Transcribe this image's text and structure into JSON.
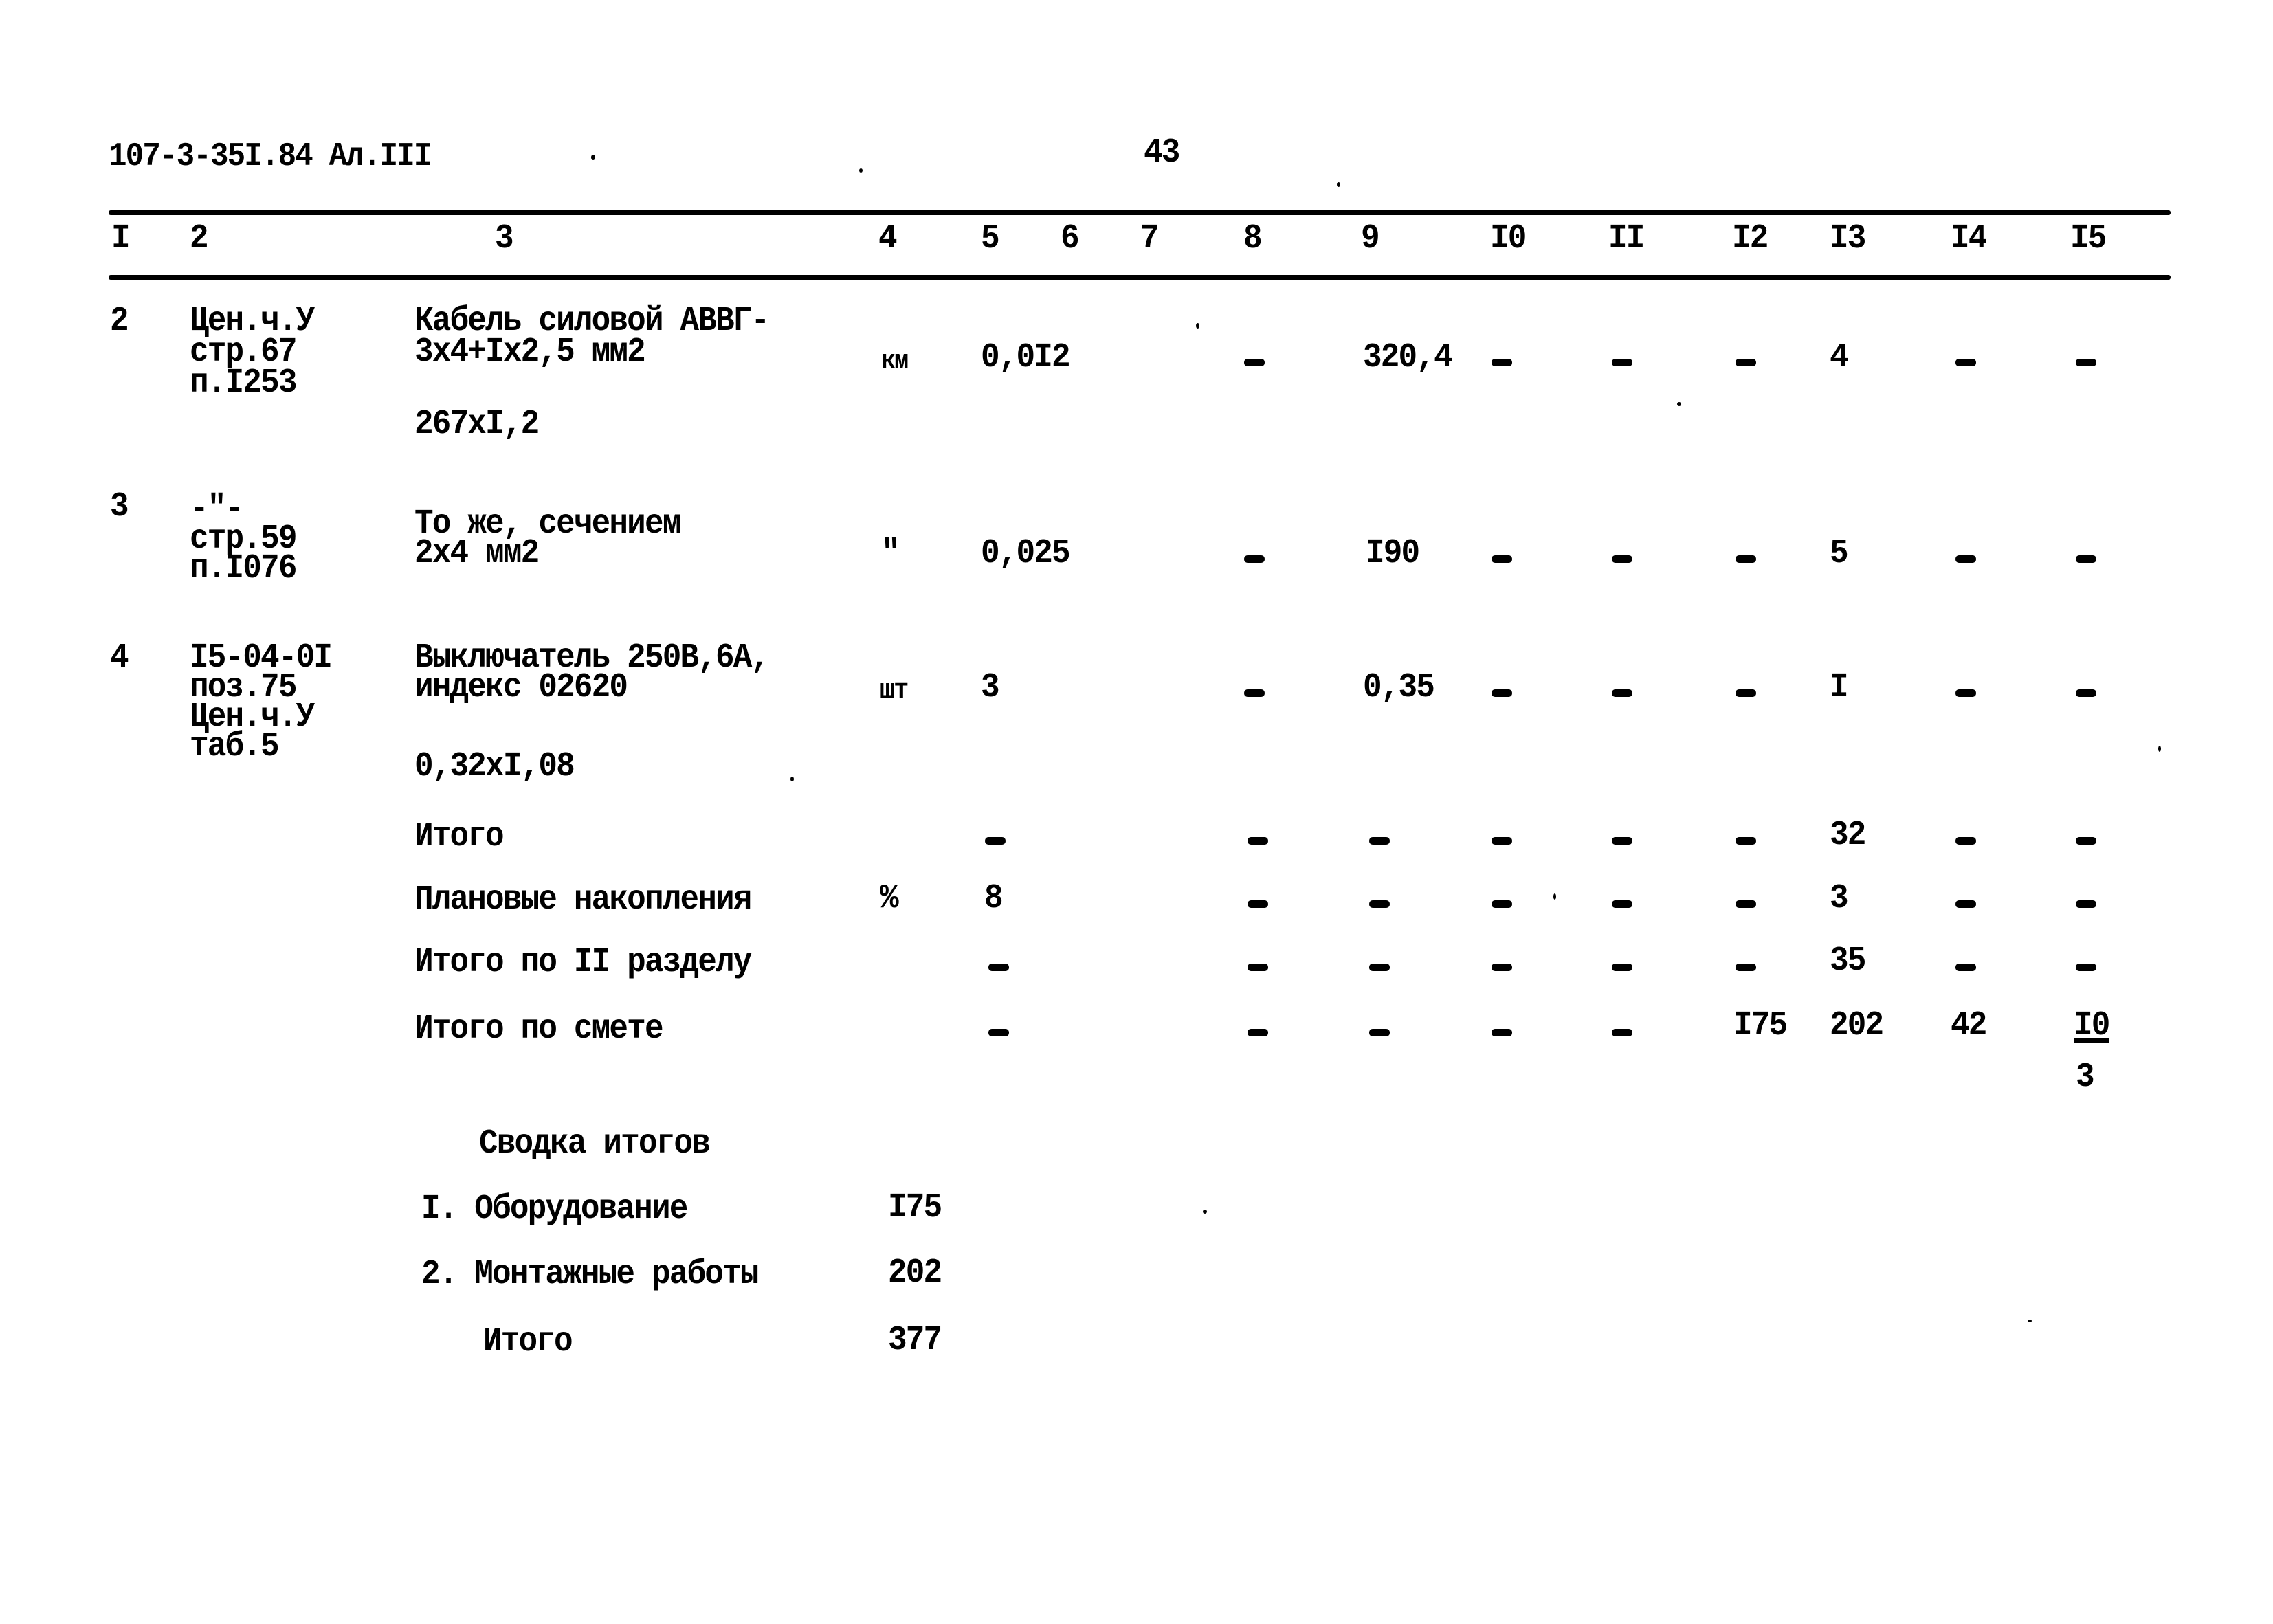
{
  "header": {
    "doc_code": "107-3-35I.84 Ал.III",
    "page_number": "43"
  },
  "column_numbers": [
    "I",
    "2",
    "3",
    "4",
    "5",
    "6",
    "7",
    "8",
    "9",
    "I0",
    "II",
    "I2",
    "I3",
    "I4",
    "I5"
  ],
  "rows": [
    {
      "no": "2",
      "ref": [
        "Цен.ч.У",
        "стр.67",
        "п.I253"
      ],
      "name": [
        "Кабель силовой АВВГ-",
        "3x4+Ix2,5 мм2"
      ],
      "calc": "267xI,2",
      "unit": "км",
      "c5": "0,0I2",
      "c8": "-",
      "c9": "320,4",
      "c10": "-",
      "c11": "-",
      "c12": "-",
      "c13": "4",
      "c14": "-",
      "c15": "-"
    },
    {
      "no": "3",
      "ref": [
        "-\"-",
        "стр.59",
        "п.I076"
      ],
      "name": [
        "То же, сечением",
        "2x4 мм2"
      ],
      "calc": "",
      "unit": "\"",
      "c5": "0,025",
      "c8": "-",
      "c9": "I90",
      "c10": "-",
      "c11": "-",
      "c12": "-",
      "c13": "5",
      "c14": "-",
      "c15": "-"
    },
    {
      "no": "4",
      "ref": [
        "I5-04-0I",
        "поз.75",
        "Цен.ч.У",
        "таб.5"
      ],
      "name": [
        "Выключатель 250В,6А,",
        "индекс 02620"
      ],
      "calc": "0,32xI,08",
      "unit": "шт",
      "c5": "3",
      "c8": "-",
      "c9": "0,35",
      "c10": "-",
      "c11": "-",
      "c12": "-",
      "c13": "I",
      "c14": "-",
      "c15": "-"
    }
  ],
  "totals": [
    {
      "label": "Итого",
      "unit": "",
      "c5": "-",
      "c8": "-",
      "c9": "-",
      "c10": "-",
      "c11": "-",
      "c12": "-",
      "c13": "32",
      "c14": "-",
      "c15": "-"
    },
    {
      "label": "Плановые накопления",
      "unit": "%",
      "c5": "8",
      "c8": "-",
      "c9": "-",
      "c10": "-",
      "c11": "-",
      "c12": "-",
      "c13": "3",
      "c14": "-",
      "c15": "-"
    },
    {
      "label": "Итого по II разделу",
      "unit": "",
      "c5": "-",
      "c8": "-",
      "c9": "-",
      "c10": "-",
      "c11": "-",
      "c12": "-",
      "c13": "35",
      "c14": "-",
      "c15": "-"
    },
    {
      "label": "Итого по смете",
      "unit": "",
      "c5": "-",
      "c8": "-",
      "c9": "-",
      "c10": "-",
      "c11": "-",
      "c12": "I75",
      "c13": "202",
      "c14": "42",
      "c15_top": "I0",
      "c15_bottom": "3"
    }
  ],
  "summary": {
    "title": "Сводка итогов",
    "items": [
      {
        "label": "I. Оборудование",
        "value": "I75"
      },
      {
        "label": "2. Монтажные работы",
        "value": "202"
      },
      {
        "label": "Итого",
        "value": "377"
      }
    ]
  }
}
